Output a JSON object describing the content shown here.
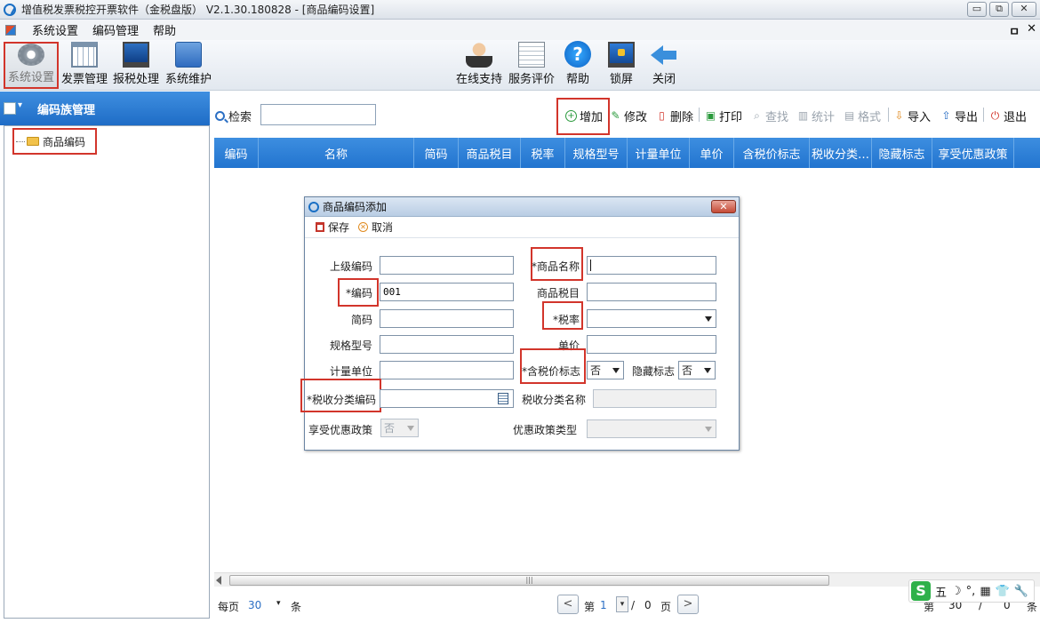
{
  "window": {
    "title": "增值税发票税控开票软件（金税盘版） V2.1.30.180828 - [商品编码设置]",
    "buttons": [
      "▭",
      "⧉",
      "✕"
    ]
  },
  "menubar": {
    "items": [
      "系统设置",
      "编码管理",
      "帮助"
    ],
    "right": [
      "ㅁ",
      "✕"
    ]
  },
  "toolbar": {
    "left": [
      {
        "label": "系统设置",
        "icon": "gear-icon"
      },
      {
        "label": "发票管理",
        "icon": "grid-icon"
      },
      {
        "label": "报税处理",
        "icon": "monitor-icon"
      },
      {
        "label": "系统维护",
        "icon": "folder-icon"
      }
    ],
    "right": [
      {
        "label": "在线支持",
        "icon": "person-icon"
      },
      {
        "label": "服务评价",
        "icon": "document-icon"
      },
      {
        "label": "帮助",
        "icon": "help-icon"
      },
      {
        "label": "锁屏",
        "icon": "lock-icon"
      },
      {
        "label": "关闭",
        "icon": "arrow-icon"
      }
    ]
  },
  "left_panel": {
    "title": "编码族管理",
    "tree": [
      "商品编码"
    ]
  },
  "search": {
    "label": "检索",
    "value": ""
  },
  "actions": [
    {
      "label": "增加",
      "icon": "⊕",
      "enabled": true
    },
    {
      "label": "修改",
      "icon": "✎",
      "enabled": true
    },
    {
      "label": "删除",
      "icon": "🗑",
      "enabled": true
    },
    {
      "label": "打印",
      "icon": "⎙",
      "enabled": true
    },
    {
      "label": "查找",
      "icon": "⌕",
      "enabled": false
    },
    {
      "label": "统计",
      "icon": "▥",
      "enabled": false
    },
    {
      "label": "格式",
      "icon": "▤",
      "enabled": false
    },
    {
      "label": "导入",
      "icon": "⇩",
      "enabled": true
    },
    {
      "label": "导出",
      "icon": "⇧",
      "enabled": true
    },
    {
      "label": "退出",
      "icon": "⏻",
      "enabled": true
    }
  ],
  "table": {
    "columns": [
      "编码",
      "名称",
      "简码",
      "商品税目",
      "税率",
      "规格型号",
      "计量单位",
      "单价",
      "含税价标志",
      "税收分类…",
      "隐藏标志",
      "享受优惠政策"
    ]
  },
  "pager": {
    "per_page_label": "每页",
    "per_page": "30",
    "unit": "条",
    "page_prefix": "第",
    "current_page": "1",
    "slash": "/",
    "total_pages": "0",
    "page_suffix": "页",
    "right_prefix": "第",
    "right_value": "30",
    "right_slash": "/",
    "right_total": "0",
    "right_suffix": "条"
  },
  "ime": {
    "logo": "S",
    "items": [
      "五",
      "☽",
      "°,",
      "▦",
      "👕",
      "🔧"
    ]
  },
  "dialog": {
    "title": "商品编码添加",
    "close": "✕",
    "save": "保存",
    "cancel": "取消",
    "fields": {
      "parent_code": {
        "label": "上级编码",
        "value": ""
      },
      "product_name": {
        "label": "*商品名称",
        "value": ""
      },
      "code": {
        "label": "*编码",
        "value": "001"
      },
      "tax_item": {
        "label": "商品税目",
        "value": ""
      },
      "short_code": {
        "label": "简码",
        "value": ""
      },
      "tax_rate": {
        "label": "*税率",
        "value": ""
      },
      "spec": {
        "label": "规格型号",
        "value": ""
      },
      "unit_price": {
        "label": "单价",
        "value": ""
      },
      "unit": {
        "label": "计量单位",
        "value": ""
      },
      "tax_included": {
        "label": "*含税价标志",
        "value": "否"
      },
      "hidden_flag": {
        "label": "隐藏标志",
        "value": "否"
      },
      "tax_class_code": {
        "label": "*税收分类编码",
        "value": ""
      },
      "tax_class_name": {
        "label": "税收分类名称",
        "value": ""
      },
      "preferential": {
        "label": "享受优惠政策",
        "value": "否"
      },
      "preferential_type": {
        "label": "优惠政策类型",
        "value": ""
      }
    }
  },
  "colors": {
    "highlight": "#d2352b",
    "header_blue": "#2274cf"
  }
}
